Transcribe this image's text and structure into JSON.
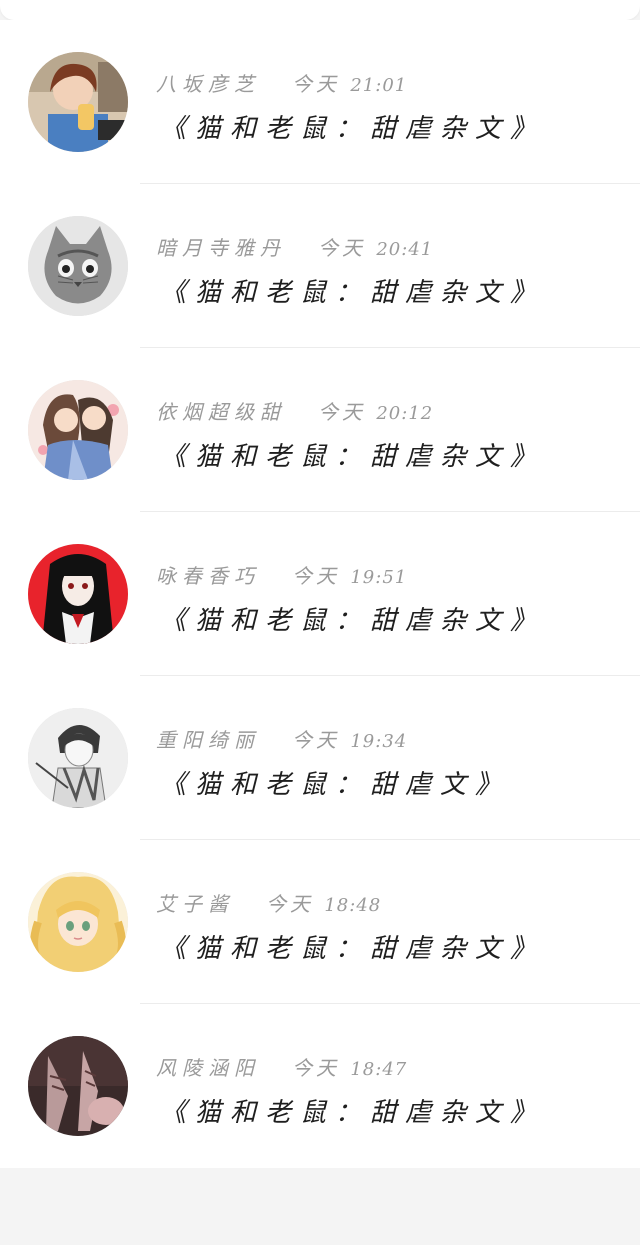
{
  "colors": {
    "background": "#f4f4f4",
    "card": "#ffffff",
    "meta_text": "#9a9a9a",
    "title_text": "#1f1f1f",
    "divider": "#ececec"
  },
  "messages": [
    {
      "author": "八坂彦芝",
      "day": "今天",
      "time": "21:01",
      "title": "《猫和老鼠：甜虐杂文》",
      "avatar": "girl-photo-avatar"
    },
    {
      "author": "暗月寺雅丹",
      "day": "今天",
      "time": "20:41",
      "title": "《猫和老鼠：甜虐杂文》",
      "avatar": "kitten-sketch-avatar"
    },
    {
      "author": "依烟超级甜",
      "day": "今天",
      "time": "20:12",
      "title": "《猫和老鼠：甜虐杂文》",
      "avatar": "anime-couple-avatar"
    },
    {
      "author": "咏春香巧",
      "day": "今天",
      "time": "19:51",
      "title": "《猫和老鼠：甜虐杂文》",
      "avatar": "anime-girl-red-avatar"
    },
    {
      "author": "重阳绮丽",
      "day": "今天",
      "time": "19:34",
      "title": "《猫和老鼠：甜虐文》",
      "avatar": "anime-boy-sketch-avatar"
    },
    {
      "author": "艾子酱",
      "day": "今天",
      "time": "18:48",
      "title": "《猫和老鼠：甜虐杂文》",
      "avatar": "blonde-anime-girl-avatar"
    },
    {
      "author": "风陵涵阳",
      "day": "今天",
      "time": "18:47",
      "title": "《猫和老鼠：甜虐杂文》",
      "avatar": "dark-photo-avatar"
    }
  ]
}
